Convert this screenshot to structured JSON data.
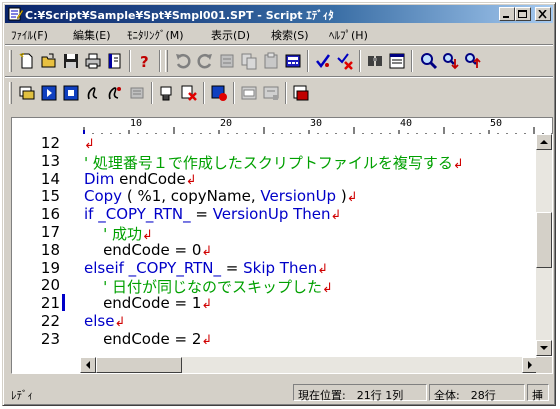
{
  "window": {
    "title": "C:¥Script¥Sample¥Spt¥Smpl001.SPT - Script ｴﾃﾞｨﾀ"
  },
  "menu": [
    {
      "label": "ﾌｧｲﾙ(F)"
    },
    {
      "label": "編集(E)"
    },
    {
      "label": "ﾓﾆﾀﾘﾝｸﾞ(M)"
    },
    {
      "label": "表示(D)"
    },
    {
      "label": "検索(S)"
    },
    {
      "label": "ﾍﾙﾌﾟ(H)"
    }
  ],
  "toolbar1": [
    "new-icon",
    "open-icon",
    "save-icon",
    "print-icon",
    "notebook-icon",
    "help-icon",
    "undo-icon",
    "redo-icon",
    "cut-icon",
    "copy-icon",
    "paste-icon",
    "calculator-icon",
    "check-icon",
    "compile-error-icon",
    "find-icon",
    "properties-icon",
    "search-icon",
    "find-next-icon",
    "find-prev-icon"
  ],
  "toolbar2": [
    "monitor-icon",
    "run-icon",
    "stop-icon",
    "step-icon",
    "step-over-icon",
    "settings-icon",
    "print-cursor-icon",
    "clear-breakpoint-icon",
    "breakpoint-icon",
    "window-icon",
    "screen-icon",
    "export-icon"
  ],
  "ruler": {
    "labels": [
      "10",
      "20",
      "30",
      "40",
      "50"
    ]
  },
  "editor": {
    "current_line_index": 9,
    "lines": [
      {
        "no": "12",
        "tokens": [
          {
            "t": "",
            "c": "black"
          }
        ],
        "mark": "↲"
      },
      {
        "no": "13",
        "tokens": [
          {
            "t": "' 処理番号１で作成したスクリプトファイルを複写する",
            "c": "green"
          }
        ],
        "mark": "↲"
      },
      {
        "no": "14",
        "tokens": [
          {
            "t": "Dim",
            "c": "blue"
          },
          {
            "t": " endCode",
            "c": "black"
          }
        ],
        "mark": "↲"
      },
      {
        "no": "15",
        "tokens": [
          {
            "t": "Copy",
            "c": "blue"
          },
          {
            "t": " ( %1, copyName, ",
            "c": "black"
          },
          {
            "t": "VersionUp",
            "c": "blue"
          },
          {
            "t": " )",
            "c": "black"
          }
        ],
        "mark": "↲"
      },
      {
        "no": "16",
        "tokens": [
          {
            "t": "if _COPY_RTN_",
            "c": "blue"
          },
          {
            "t": " = ",
            "c": "black"
          },
          {
            "t": "VersionUp Then",
            "c": "blue"
          }
        ],
        "mark": "↲"
      },
      {
        "no": "17",
        "tokens": [
          {
            "t": "    ' 成功",
            "c": "green"
          }
        ],
        "mark": "↲"
      },
      {
        "no": "18",
        "tokens": [
          {
            "t": "    endCode = 0",
            "c": "black"
          }
        ],
        "mark": "↲"
      },
      {
        "no": "19",
        "tokens": [
          {
            "t": "elseif _COPY_RTN_",
            "c": "blue"
          },
          {
            "t": " = ",
            "c": "black"
          },
          {
            "t": "Skip Then",
            "c": "blue"
          }
        ],
        "mark": "↲"
      },
      {
        "no": "20",
        "tokens": [
          {
            "t": "    ' 日付が同じなのでスキップした",
            "c": "green"
          }
        ],
        "mark": "↲"
      },
      {
        "no": "21",
        "tokens": [
          {
            "t": "    endCode = 1",
            "c": "black"
          }
        ],
        "mark": "↲"
      },
      {
        "no": "22",
        "tokens": [
          {
            "t": "else",
            "c": "blue"
          }
        ],
        "mark": "↲"
      },
      {
        "no": "23",
        "tokens": [
          {
            "t": "    endCode = 2",
            "c": "black"
          }
        ],
        "mark": "↲"
      }
    ]
  },
  "status": {
    "mode": "ﾚﾃﾞｨ",
    "position": "現在位置:　21行 1列",
    "total": "全体:　28行",
    "insert": "挿"
  },
  "colors": {
    "keyword": "#0000c8",
    "comment": "#00a000",
    "linebreak_mark": "#d00000",
    "titlebar": "#0a246a"
  }
}
